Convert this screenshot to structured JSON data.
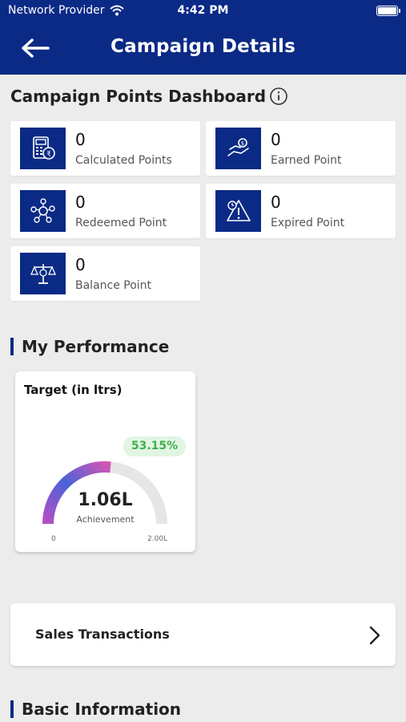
{
  "status_bar": {
    "carrier": "Network Provider",
    "time": "4:42 PM"
  },
  "header": {
    "title": "Campaign Details",
    "back_icon": "arrow-left-icon"
  },
  "dashboard": {
    "title": "Campaign Points Dashboard",
    "cards": [
      {
        "value": "0",
        "label": "Calculated Points",
        "icon": "calculator-rupee-icon"
      },
      {
        "value": "0",
        "label": "Earned Point",
        "icon": "hand-coin-icon"
      },
      {
        "value": "0",
        "label": "Redeemed Point",
        "icon": "coins-network-icon"
      },
      {
        "value": "0",
        "label": "Expired Point",
        "icon": "warning-clock-icon"
      },
      {
        "value": "0",
        "label": "Balance Point",
        "icon": "balance-scale-icon"
      }
    ]
  },
  "performance": {
    "title": "My Performance",
    "card_title": "Target (in ltrs)",
    "percent_text": "53.15%",
    "progress": 0.5315,
    "achievement_value": "1.06L",
    "achievement_label": "Achievement",
    "min_label": "0",
    "max_label": "2.00L"
  },
  "sales": {
    "label": "Sales Transactions"
  },
  "basic_info": {
    "title": "Basic Information"
  },
  "colors": {
    "brand": "#0a2a86",
    "badge_text": "#3fb14b",
    "badge_bg": "#e2f5e3",
    "gauge_track": "#e6e6e6"
  }
}
